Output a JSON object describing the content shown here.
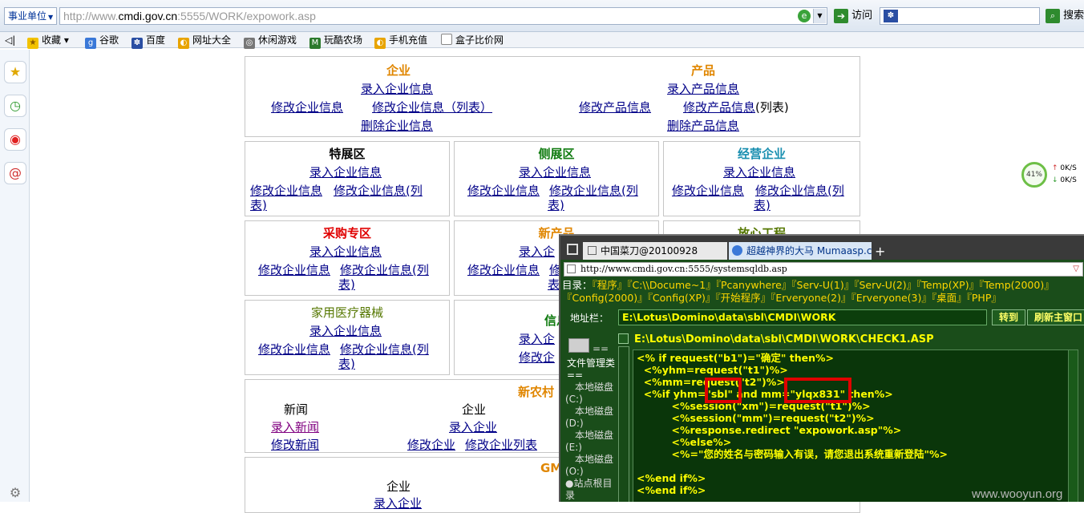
{
  "browser": {
    "scope_label": "事业单位",
    "url_prefix": "http://www.",
    "url_domain": "cmdi.gov.cn",
    "url_rest": ":5555/WORK/expowork.asp",
    "visit_label": "访问",
    "search_label": "搜索",
    "favorites": {
      "collect": "收藏",
      "google": "谷歌",
      "baidu": "百度",
      "sites": "网址大全",
      "games": "休闲游戏",
      "farm": "玩酷农场",
      "recharge": "手机充值",
      "compare": "盒子比价网"
    }
  },
  "page": {
    "enterprise": {
      "title": "企业",
      "add": "录入企业信息",
      "edit": "修改企业信息",
      "edit_list": "修改企业信息（列表）",
      "delete": "删除企业信息"
    },
    "product": {
      "title": "产品",
      "add": "录入产品信息",
      "edit": "修改产品信息",
      "edit_list": "修改产品信息",
      "edit_list_suffix": "(列表)",
      "delete": "删除产品信息"
    },
    "boxes": {
      "special": {
        "title": "特展区",
        "add": "录入企业信息",
        "edit": "修改企业信息",
        "edit_list_1": "修改企业信息(列",
        "edit_list_2": "表)"
      },
      "side": {
        "title": "侧展区",
        "add": "录入企业信息",
        "edit": "修改企业信息",
        "edit_list_1": "修改企业信息(列",
        "edit_list_2": "表)"
      },
      "operating": {
        "title": "经营企业",
        "add": "录入企业信息",
        "edit": "修改企业信息",
        "edit_list_1": "修改企业信息(列",
        "edit_list_2": "表)"
      },
      "purchase": {
        "title": "采购专区",
        "add": "录入企业信息",
        "edit": "修改企业信息",
        "edit_list_1": "修改企业信息(列",
        "edit_list_2": "表)"
      },
      "newproduct": {
        "title": "新产品",
        "add": "录入企",
        "edit": "修改企业信息",
        "edit_list_1": "修",
        "edit_list_2": "表"
      },
      "assured": {
        "title": "放心工程"
      },
      "medical": {
        "title": "家用医疗器械",
        "add": "录入企业信息",
        "edit": "修改企业信息",
        "edit_list_1": "修改企业信息(列",
        "edit_list_2": "表)"
      },
      "info": {
        "title": "信息",
        "add": "录入企",
        "edit": "修改企"
      }
    },
    "newvillage": {
      "title": "新农村",
      "news_head": "新闻",
      "news_add": "录入新闻",
      "news_edit": "修改新闻",
      "ent_head": "企业",
      "ent_add": "录入企业",
      "ent_edit": "修改企业",
      "ent_edit_list": "修改企业列表"
    },
    "gmp": {
      "title": "GM",
      "ent_head": "企业",
      "ent_add": "录入企业"
    }
  },
  "popup": {
    "tab1": "中国菜刀@20100928",
    "tab2": "超越神界的大马 Mumaasp.c...",
    "address": "http://www.cmdi.gov.cn:5555/systemsqldb.asp",
    "dir_label": "目录：",
    "dirs_line1": "『程序』『C:\\\\Docume~1』『Pcanywhere』『Serv-U(1)』『Serv-U(2)』『Temp(XP)』『Temp(2000)』",
    "dirs_line2": "『Config(2000)』『Config(XP)』『开始程序』『Erveryone(2)』『Erveryone(3)』『桌面』『PHP』",
    "addr_label": "地址栏：",
    "path": "E:\\Lotus\\Domino\\data\\sbl\\CMDI\\WORK",
    "goto_btn": "转到",
    "refresh_btn": "刷新主窗口",
    "file_path": "E:\\Lotus\\Domino\\data\\sbl\\CMDI\\WORK\\CHECK1.ASP",
    "left": {
      "eq": "==",
      "file_mgr": "文件管理类",
      "eq2": "==",
      "disk_c": "本地磁盘(C:)",
      "disk_d": "本地磁盘(D:)",
      "disk_e": "本地磁盘(E:)",
      "disk_o": "本地磁盘(O:)",
      "site_root": "●站点根目录"
    },
    "code_lines": [
      "<% if request(\"b1\")=\"确定\" then%>",
      "  <%yhm=request(\"t1\")%>",
      "  <%mm=request(\"t2\")%>",
      "  <%if yhm=\"sbl\" and mm=\"ylqx831\" then%>",
      "          <%session(\"xm\")=request(\"t1\")%>",
      "          <%session(\"mm\")=request(\"t2\")%>",
      "          <%response.redirect \"expowork.asp\"%>",
      "          <%else%>",
      "          <%=\"您的姓名与密码输入有误，请您退出系统重新登陆\"%>",
      "",
      "<%end if%>",
      "<%end if%>"
    ]
  },
  "speed": {
    "percent": "41%",
    "up": "0K/S",
    "down": "0K/S"
  },
  "watermark": "www.wooyun.org"
}
